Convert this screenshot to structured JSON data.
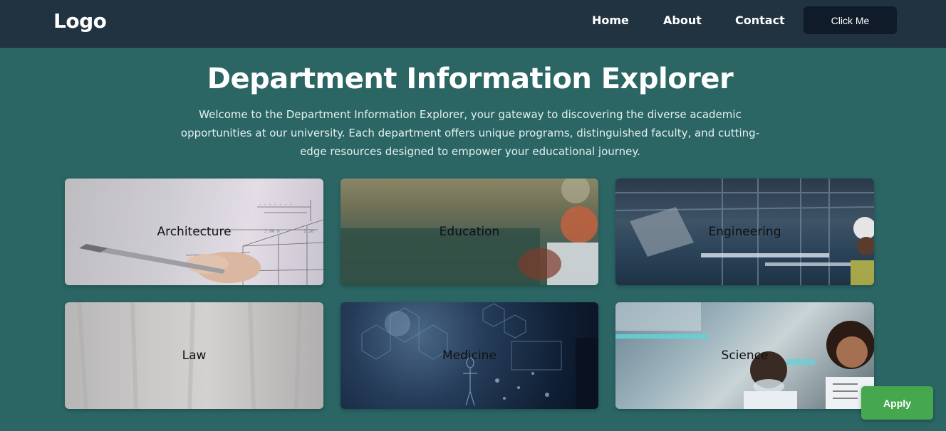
{
  "header": {
    "logo": "Logo",
    "nav": [
      {
        "label": "Home"
      },
      {
        "label": "About"
      },
      {
        "label": "Contact"
      }
    ],
    "cta_label": "Click Me"
  },
  "main": {
    "title": "Department Information Explorer",
    "intro": "Welcome to the Department Information Explorer, your gateway to discovering the diverse academic opportunities at our university. Each department offers unique programs, distinguished faculty, and cutting-edge resources designed to empower your educational journey.",
    "departments": [
      {
        "name": "Architecture"
      },
      {
        "name": "Education"
      },
      {
        "name": "Engineering"
      },
      {
        "name": "Law"
      },
      {
        "name": "Medicine"
      },
      {
        "name": "Science"
      }
    ]
  },
  "apply_label": "Apply",
  "colors": {
    "navbar": "#213240",
    "page_background": "#2b6665",
    "cta_button": "#0f1b28",
    "apply_button": "#45a84f"
  }
}
